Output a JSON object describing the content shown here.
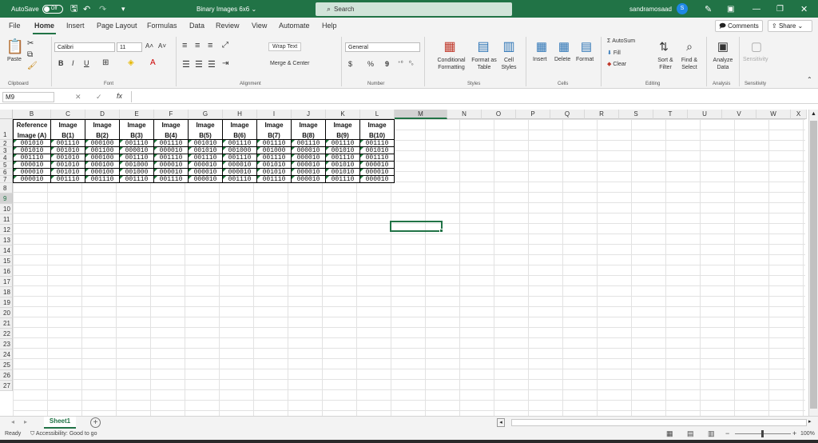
{
  "titlebar": {
    "autosave_label": "AutoSave",
    "autosave_state": "Off",
    "doc_title": "Binary Images 6x6",
    "search_placeholder": "Search",
    "user_name": "sandramosaad",
    "user_initial": "S"
  },
  "menu": {
    "items": [
      "File",
      "Home",
      "Insert",
      "Page Layout",
      "Formulas",
      "Data",
      "Review",
      "View",
      "Automate",
      "Help"
    ],
    "active": "Home",
    "comments": "Comments",
    "share": "Share"
  },
  "ribbon": {
    "clipboard": {
      "paste": "Paste",
      "label": "Clipboard"
    },
    "font": {
      "name": "Calibri",
      "size": "11",
      "bold": "B",
      "italic": "I",
      "underline": "U",
      "label": "Font",
      "grow": "A˄",
      "shrink": "A˅"
    },
    "alignment": {
      "wrap": "Wrap Text",
      "merge": "Merge & Center",
      "label": "Alignment"
    },
    "number": {
      "format": "General",
      "currency": "$",
      "percent": "%",
      "comma": "9",
      "label": "Number"
    },
    "styles": {
      "conditional": "Conditional Formatting",
      "format_table": "Format as Table",
      "cell_styles": "Cell Styles",
      "label": "Styles"
    },
    "cells": {
      "insert": "Insert",
      "delete": "Delete",
      "format": "Format",
      "label": "Cells"
    },
    "editing": {
      "autosum": "AutoSum",
      "fill": "Fill",
      "clear": "Clear",
      "sort": "Sort & Filter",
      "find": "Find & Select",
      "label": "Editing"
    },
    "analysis": {
      "analyze": "Analyze Data",
      "label": "Analysis"
    },
    "sensitivity": {
      "btn": "Sensitivity",
      "label": "Sensitivity"
    }
  },
  "formula_bar": {
    "name_box": "M9",
    "fx": "fx",
    "value": ""
  },
  "columns": [
    "B",
    "C",
    "D",
    "E",
    "F",
    "G",
    "H",
    "I",
    "J",
    "K",
    "L",
    "M",
    "N",
    "O",
    "P",
    "Q",
    "R",
    "S",
    "T",
    "U",
    "V",
    "W",
    "X"
  ],
  "rows": [
    "1",
    "2",
    "3",
    "4",
    "5",
    "6",
    "7",
    "8",
    "9",
    "10",
    "11",
    "12",
    "13",
    "14",
    "15",
    "16",
    "17",
    "18",
    "19",
    "20",
    "21",
    "22",
    "23",
    "24",
    "25",
    "26",
    "27"
  ],
  "table": {
    "headers": [
      [
        "Reference",
        "Image (A)"
      ],
      [
        "Image",
        "B(1)"
      ],
      [
        "Image",
        "B(2)"
      ],
      [
        "Image",
        "B(3)"
      ],
      [
        "Image",
        "B(4)"
      ],
      [
        "Image",
        "B(5)"
      ],
      [
        "Image",
        "B(6)"
      ],
      [
        "Image",
        "B(7)"
      ],
      [
        "Image",
        "B(8)"
      ],
      [
        "Image",
        "B(9)"
      ],
      [
        "Image",
        "B(10)"
      ]
    ],
    "rows": [
      [
        "001010",
        "001110",
        "000100",
        "001110",
        "001110",
        "001010",
        "001110",
        "001110",
        "001110",
        "001110",
        "001110"
      ],
      [
        "001010",
        "001010",
        "001100",
        "000010",
        "000010",
        "001010",
        "001000",
        "001000",
        "000010",
        "001010",
        "001010"
      ],
      [
        "001110",
        "001010",
        "000100",
        "001110",
        "001110",
        "001110",
        "001110",
        "001110",
        "000010",
        "001110",
        "001110"
      ],
      [
        "000010",
        "001010",
        "000100",
        "001000",
        "000010",
        "000010",
        "000010",
        "001010",
        "000010",
        "001010",
        "000010"
      ],
      [
        "000010",
        "001010",
        "000100",
        "001000",
        "000010",
        "000010",
        "000010",
        "001010",
        "000010",
        "001010",
        "000010"
      ],
      [
        "000010",
        "001110",
        "001110",
        "001110",
        "001110",
        "000010",
        "001110",
        "001110",
        "000010",
        "001110",
        "000010"
      ]
    ]
  },
  "sheets": {
    "active": "Sheet1",
    "add": "+"
  },
  "status": {
    "ready": "Ready",
    "accessibility": "Accessibility: Good to go",
    "zoom": "100%"
  }
}
